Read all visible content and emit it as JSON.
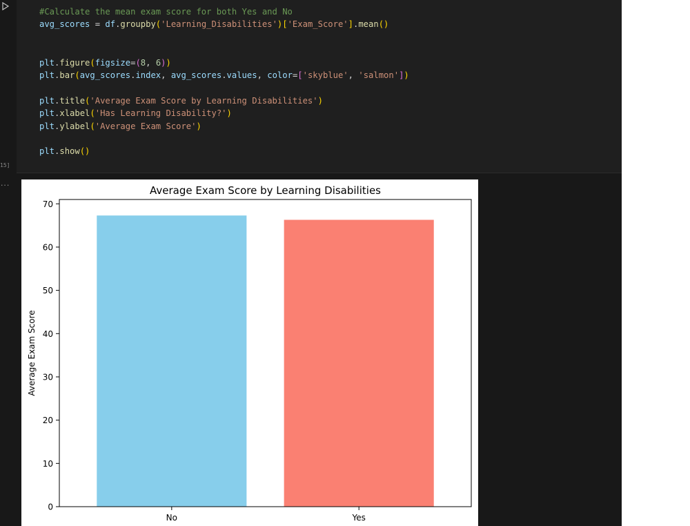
{
  "cell": {
    "execution_count": "15]",
    "output_marker": "...",
    "code_lines": [
      [
        {
          "t": "#Calculate the mean exam score for both Yes and No",
          "c": "tk-comment"
        }
      ],
      [
        {
          "t": "avg_scores",
          "c": "tk-var"
        },
        {
          "t": " = ",
          "c": "tk-op"
        },
        {
          "t": "df",
          "c": "tk-var"
        },
        {
          "t": ".",
          "c": "tk-op"
        },
        {
          "t": "groupby",
          "c": "tk-func"
        },
        {
          "t": "(",
          "c": "tk-br1"
        },
        {
          "t": "'Learning_Disabilities'",
          "c": "tk-str"
        },
        {
          "t": ")",
          "c": "tk-br1"
        },
        {
          "t": "[",
          "c": "tk-br1"
        },
        {
          "t": "'Exam_Score'",
          "c": "tk-str"
        },
        {
          "t": "]",
          "c": "tk-br1"
        },
        {
          "t": ".",
          "c": "tk-op"
        },
        {
          "t": "mean",
          "c": "tk-func"
        },
        {
          "t": "()",
          "c": "tk-br1"
        }
      ],
      [],
      [],
      [
        {
          "t": "plt",
          "c": "tk-var"
        },
        {
          "t": ".",
          "c": "tk-op"
        },
        {
          "t": "figure",
          "c": "tk-func"
        },
        {
          "t": "(",
          "c": "tk-br1"
        },
        {
          "t": "figsize",
          "c": "tk-param"
        },
        {
          "t": "=",
          "c": "tk-op"
        },
        {
          "t": "(",
          "c": "tk-br2"
        },
        {
          "t": "8",
          "c": "tk-num"
        },
        {
          "t": ", ",
          "c": "tk-op"
        },
        {
          "t": "6",
          "c": "tk-num"
        },
        {
          "t": ")",
          "c": "tk-br2"
        },
        {
          "t": ")",
          "c": "tk-br1"
        }
      ],
      [
        {
          "t": "plt",
          "c": "tk-var"
        },
        {
          "t": ".",
          "c": "tk-op"
        },
        {
          "t": "bar",
          "c": "tk-func"
        },
        {
          "t": "(",
          "c": "tk-br1"
        },
        {
          "t": "avg_scores",
          "c": "tk-var"
        },
        {
          "t": ".",
          "c": "tk-op"
        },
        {
          "t": "index",
          "c": "tk-var"
        },
        {
          "t": ", ",
          "c": "tk-op"
        },
        {
          "t": "avg_scores",
          "c": "tk-var"
        },
        {
          "t": ".",
          "c": "tk-op"
        },
        {
          "t": "values",
          "c": "tk-var"
        },
        {
          "t": ", ",
          "c": "tk-op"
        },
        {
          "t": "color",
          "c": "tk-param"
        },
        {
          "t": "=",
          "c": "tk-op"
        },
        {
          "t": "[",
          "c": "tk-br2"
        },
        {
          "t": "'skyblue'",
          "c": "tk-str"
        },
        {
          "t": ", ",
          "c": "tk-op"
        },
        {
          "t": "'salmon'",
          "c": "tk-str"
        },
        {
          "t": "]",
          "c": "tk-br2"
        },
        {
          "t": ")",
          "c": "tk-br1"
        }
      ],
      [],
      [
        {
          "t": "plt",
          "c": "tk-var"
        },
        {
          "t": ".",
          "c": "tk-op"
        },
        {
          "t": "title",
          "c": "tk-func"
        },
        {
          "t": "(",
          "c": "tk-br1"
        },
        {
          "t": "'Average Exam Score by Learning Disabilities'",
          "c": "tk-str"
        },
        {
          "t": ")",
          "c": "tk-br1"
        }
      ],
      [
        {
          "t": "plt",
          "c": "tk-var"
        },
        {
          "t": ".",
          "c": "tk-op"
        },
        {
          "t": "xlabel",
          "c": "tk-func"
        },
        {
          "t": "(",
          "c": "tk-br1"
        },
        {
          "t": "'Has Learning Disability?'",
          "c": "tk-str"
        },
        {
          "t": ")",
          "c": "tk-br1"
        }
      ],
      [
        {
          "t": "plt",
          "c": "tk-var"
        },
        {
          "t": ".",
          "c": "tk-op"
        },
        {
          "t": "ylabel",
          "c": "tk-func"
        },
        {
          "t": "(",
          "c": "tk-br1"
        },
        {
          "t": "'Average Exam Score'",
          "c": "tk-str"
        },
        {
          "t": ")",
          "c": "tk-br1"
        }
      ],
      [],
      [
        {
          "t": "plt",
          "c": "tk-var"
        },
        {
          "t": ".",
          "c": "tk-op"
        },
        {
          "t": "show",
          "c": "tk-func"
        },
        {
          "t": "()",
          "c": "tk-br1"
        }
      ]
    ]
  },
  "chart_data": {
    "type": "bar",
    "title": "Average Exam Score by Learning Disabilities",
    "ylabel": "Average Exam Score",
    "xlabel": "",
    "categories": [
      "No",
      "Yes"
    ],
    "values": [
      67.3,
      66.3
    ],
    "colors": [
      "#87ceeb",
      "#fa8072"
    ],
    "ylim": [
      0,
      71
    ],
    "yticks": [
      0,
      10,
      20,
      30,
      40,
      50,
      60,
      70
    ]
  }
}
